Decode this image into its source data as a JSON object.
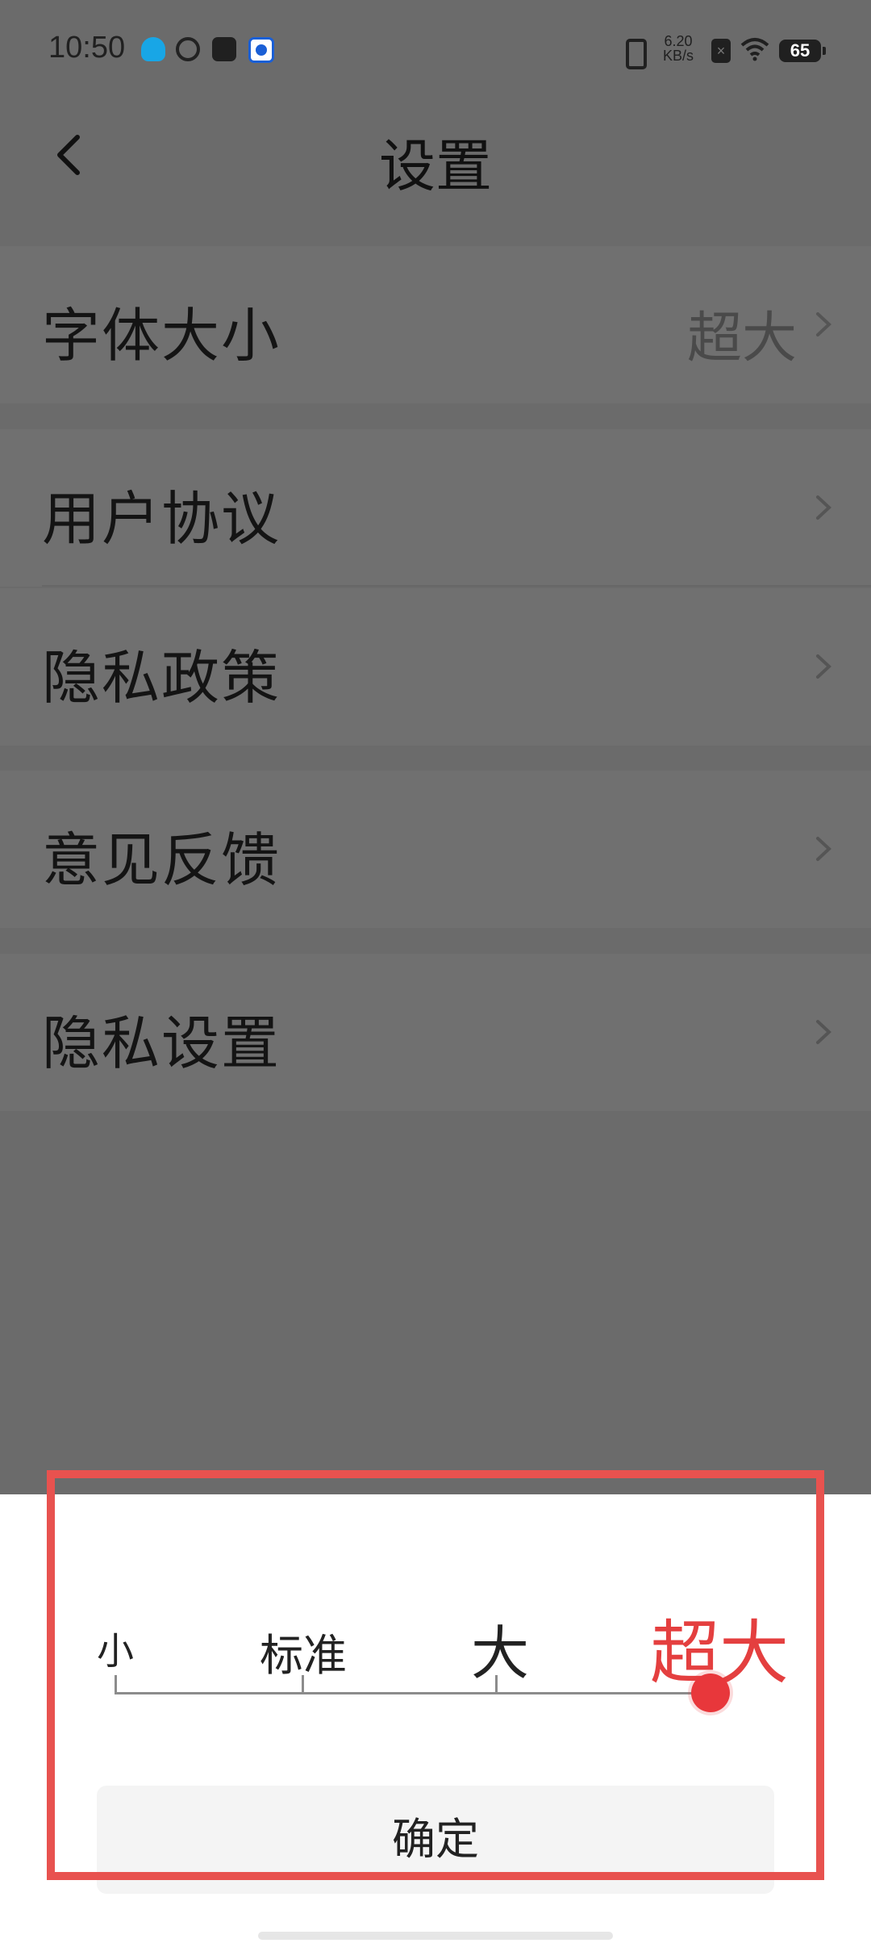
{
  "status_bar": {
    "time": "10:50",
    "net_speed_value": "6.20",
    "net_speed_unit": "KB/s",
    "battery": "65"
  },
  "header": {
    "title": "设置"
  },
  "settings": {
    "items": [
      {
        "label": "字体大小",
        "value": "超大"
      },
      {
        "label": "用户协议"
      },
      {
        "label": "隐私政策"
      },
      {
        "label": "意见反馈"
      },
      {
        "label": "隐私设置"
      }
    ]
  },
  "font_size_sheet": {
    "options": [
      "小",
      "标准",
      "大",
      "超大"
    ],
    "selected": "超大",
    "confirm_label": "确定"
  },
  "colors": {
    "accent": "#e8373b",
    "highlight_border": "#e8524f",
    "overlay": "#6b6b6b"
  },
  "icons": {
    "back": "chevron-left-icon",
    "row_arrow": "chevron-right-icon"
  }
}
